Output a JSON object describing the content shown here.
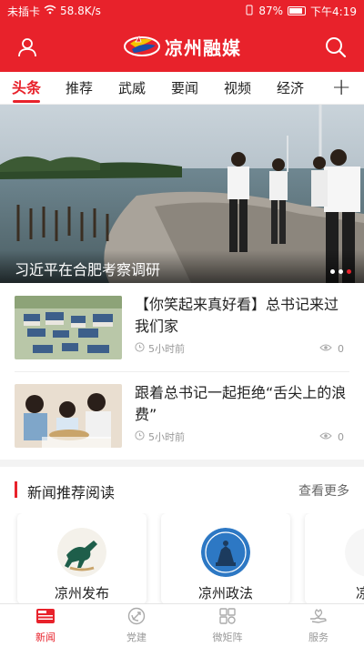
{
  "status_bar": {
    "sim": "未插卡",
    "speed": "58.8K/s",
    "battery": "87%",
    "time": "下午4:19"
  },
  "header": {
    "app_title": "凉州融媒",
    "logo_icon": "flag-swirl-logo",
    "user_icon": "user-icon",
    "search_icon": "search-icon"
  },
  "tabs": [
    {
      "label": "头条",
      "active": true
    },
    {
      "label": "推荐"
    },
    {
      "label": "武威"
    },
    {
      "label": "要闻"
    },
    {
      "label": "视频"
    },
    {
      "label": "经济"
    }
  ],
  "tab_add": "+",
  "hero": {
    "caption": "习近平在合肥考察调研",
    "slides": 3,
    "active_slide": 3
  },
  "news": [
    {
      "title": "【你笑起来真好看】总书记来过我们家",
      "time": "5小时前",
      "views": "0"
    },
    {
      "title": "跟着总书记一起拒绝“舌尖上的浪费”",
      "time": "5小时前",
      "views": "0"
    }
  ],
  "section": {
    "title": "新闻推荐阅读",
    "more": "查看更多"
  },
  "cards": [
    {
      "label": "凉州发布"
    },
    {
      "label": "凉州政法"
    },
    {
      "label": "凉州"
    }
  ],
  "bottom_nav": [
    {
      "label": "新闻",
      "icon": "news-icon",
      "active": true
    },
    {
      "label": "党建",
      "icon": "party-emblem-icon"
    },
    {
      "label": "微矩阵",
      "icon": "grid-icon"
    },
    {
      "label": "服务",
      "icon": "service-hand-icon"
    }
  ],
  "colors": {
    "brand_red": "#e8222b",
    "muted_text": "#999999"
  }
}
